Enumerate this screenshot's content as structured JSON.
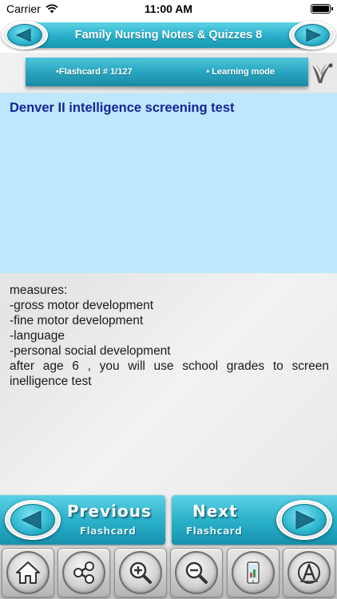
{
  "status_bar": {
    "carrier": "Carrier",
    "time": "11:00 AM"
  },
  "header": {
    "title": "Family Nursing Notes & Quizzes 8"
  },
  "info": {
    "flashcard_label": "•Flashcard #  1/127",
    "mode_label": "• Learning mode"
  },
  "card": {
    "question": "Denver II intelligence screening test",
    "answer_lines": [
      "measures:",
      "-gross motor development",
      "-fine motor development",
      "-language",
      "-personal social development"
    ],
    "answer_tail": "after age 6 , you will use school grades to screen inelligence test"
  },
  "nav": {
    "previous_big": "Previous",
    "previous_small": "Flashcard",
    "next_big": "Next",
    "next_small": "Flashcard"
  },
  "toolbar": {
    "icons": [
      "home-icon",
      "share-icon",
      "zoom-in-icon",
      "zoom-out-icon",
      "phone-icon",
      "font-icon"
    ]
  },
  "colors": {
    "accent": "#2bb2cb",
    "question_bg": "#bde8fb",
    "question_text": "#14249a"
  }
}
